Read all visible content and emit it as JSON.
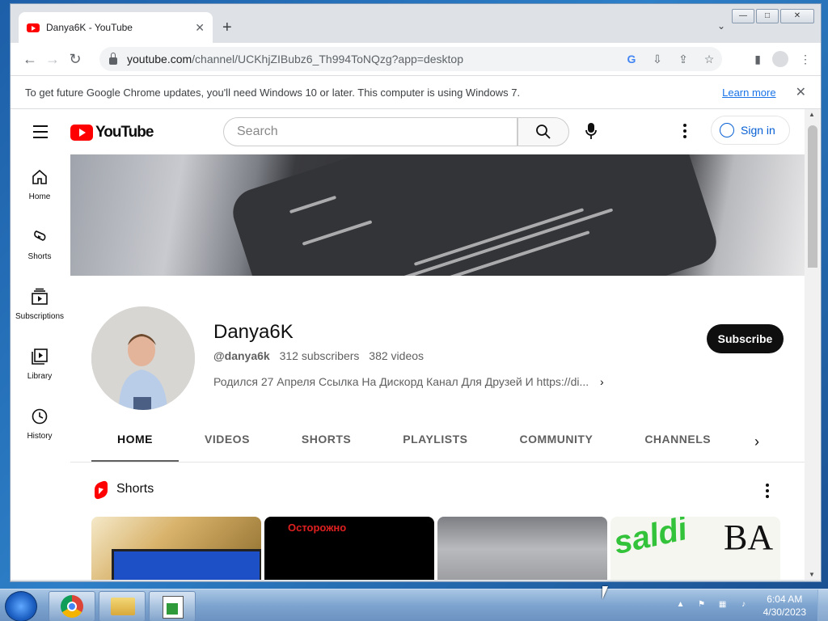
{
  "browser": {
    "tab_title": "Danya6K - YouTube",
    "tab_close": "✕",
    "new_tab": "+",
    "tab_search": "⌄",
    "url_host": "youtube.com",
    "url_path": "/channel/UCKhjZIBubz6_Th994ToNQzg?app=desktop",
    "infobar_message": "To get future Google Chrome updates, you'll need Windows 10 or later. This computer is using Windows 7.",
    "infobar_link": "Learn more",
    "infobar_close": "✕",
    "window_controls": {
      "minimize": "—",
      "maximize": "□",
      "close": "✕"
    }
  },
  "youtube": {
    "logo_text": "YouTube",
    "search_placeholder": "Search",
    "sign_in": "Sign in",
    "guide": [
      {
        "label": "Home",
        "icon": "home-icon"
      },
      {
        "label": "Shorts",
        "icon": "shorts-icon"
      },
      {
        "label": "Subscriptions",
        "icon": "subscriptions-icon"
      },
      {
        "label": "Library",
        "icon": "library-icon"
      },
      {
        "label": "History",
        "icon": "history-icon"
      }
    ]
  },
  "channel": {
    "name": "Danya6K",
    "handle": "@danya6k",
    "subscribers": "312 subscribers",
    "videos": "382 videos",
    "description": "Родился 27 Апреля Ссылка На Дискорд Канал Для Друзей И https://di...",
    "subscribe_label": "Subscribe",
    "tabs": [
      "HOME",
      "VIDEOS",
      "SHORTS",
      "PLAYLISTS",
      "COMMUNITY",
      "CHANNELS"
    ],
    "active_tab": "HOME"
  },
  "shorts_section": {
    "title": "Shorts",
    "thumbnails": [
      {
        "caption": ""
      },
      {
        "caption": "Осторожно"
      },
      {
        "caption": ""
      },
      {
        "caption": "saldi",
        "caption2": "BA"
      }
    ]
  },
  "taskbar": {
    "time": "6:04 AM",
    "date": "4/30/2023"
  },
  "colors": {
    "youtube_red": "#ff0000",
    "link_blue": "#065fd4",
    "subscribe_bg": "#0f0f0f"
  }
}
